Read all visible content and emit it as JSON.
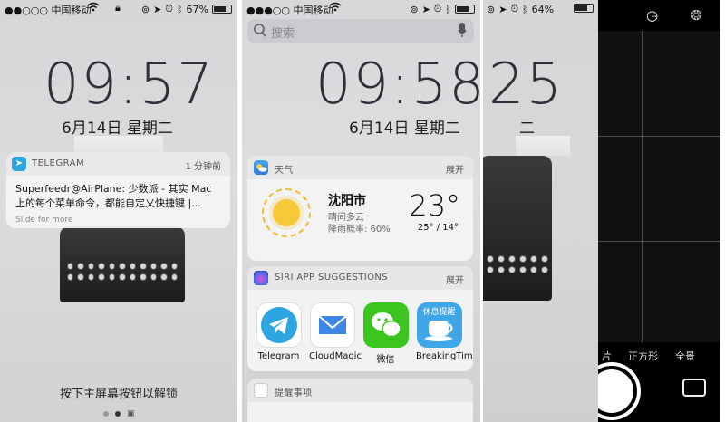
{
  "lockscreen": {
    "status": {
      "carrier": "●●○○○ 中国移动",
      "battery": "67%",
      "battery_level": 0.67
    },
    "time": "09:57",
    "date": "6月14日 星期二",
    "notification": {
      "app": "TELEGRAM",
      "time": "1 分钟前",
      "body": "Superfeedr@AirPlane: 少数派 - 其实 Mac 上的每个菜单命令，都能自定义快捷键 |...",
      "hint": "Slide for more"
    },
    "unlock_hint": "按下主屏幕按钮以解锁"
  },
  "today": {
    "status": {
      "carrier": "●●●○○ 中国移动"
    },
    "search_placeholder": "搜索",
    "time": "09:58",
    "date": "6月14日 星期二",
    "weather": {
      "title": "天气",
      "more": "展开",
      "city": "沈阳市",
      "condition": "晴间多云",
      "rain": "降雨概率: 60%",
      "temp": "23°",
      "range": "25° / 14°"
    },
    "siri": {
      "title": "SIRI APP SUGGESTIONS",
      "more": "展开",
      "apps": [
        {
          "label": "Telegram",
          "icon": "telegram-icon",
          "color": "#2ca5e0"
        },
        {
          "label": "CloudMagic",
          "icon": "mail-envelope-icon",
          "color": "#ffffff"
        },
        {
          "label": "微信",
          "icon": "wechat-icon",
          "color": "#3cc51f"
        },
        {
          "label": "BreakingTime",
          "icon": "coffee-cup-icon",
          "color": "#3fa6e8",
          "badge": "休息提醒"
        }
      ]
    },
    "reminders": {
      "title": "提醒事项"
    }
  },
  "camera": {
    "status": {
      "battery": "64%",
      "battery_level": 0.64
    },
    "time_partial": "25",
    "date_partial": "二",
    "modes": [
      "片",
      "正方形",
      "全景"
    ]
  }
}
